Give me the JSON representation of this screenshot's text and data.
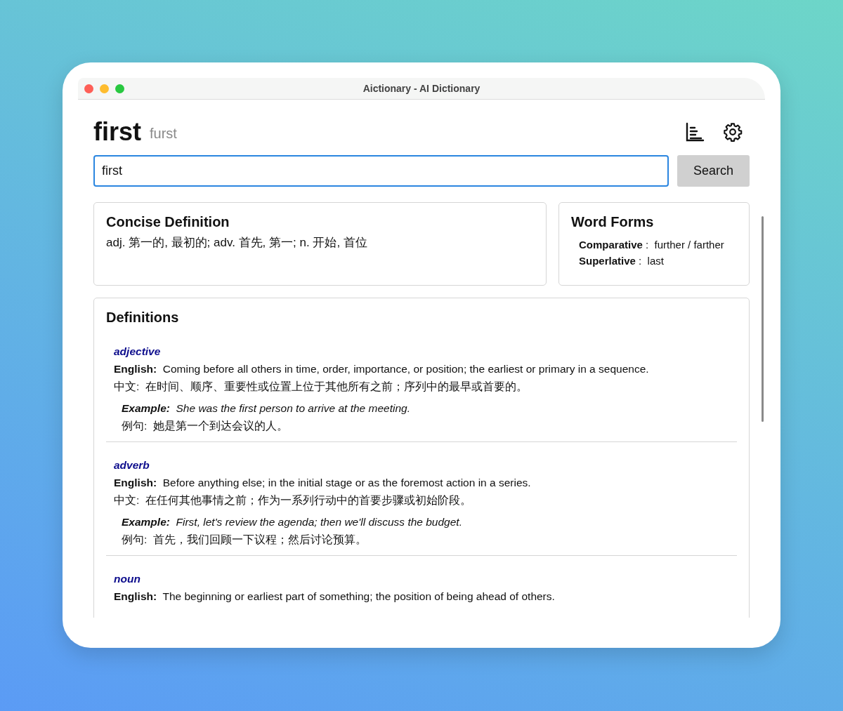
{
  "window": {
    "title": "Aictionary - AI Dictionary"
  },
  "header": {
    "word": "first",
    "pronunciation": "furst"
  },
  "search": {
    "value": "first",
    "button": "Search"
  },
  "concise": {
    "title": "Concise Definition",
    "text": "adj. 第一的, 最初的; adv. 首先, 第一; n. 开始, 首位"
  },
  "word_forms": {
    "title": "Word Forms",
    "items": [
      {
        "text": "**Comparative** :  further / farther"
      },
      {
        "text": "**Superlative** :  last"
      }
    ]
  },
  "definitions": {
    "title": "Definitions",
    "entries": [
      {
        "pos": "adjective",
        "english": "**English:**  Coming before all others in time, order, importance, or position; the earliest or primary in a sequence.",
        "chinese": "中文:  在时间、顺序、重要性或位置上位于其他所有之前；序列中的最早或首要的。",
        "example": "**Example:**  She was the first person to arrive at the meeting.",
        "example_cn": "例句:  她是第一个到达会议的人。"
      },
      {
        "pos": "adverb",
        "english": "**English:**  Before anything else; in the initial stage or as the foremost action in a series.",
        "chinese": "中文:  在任何其他事情之前；作为一系列行动中的首要步骤或初始阶段。",
        "example": "**Example:**  First, let's review the agenda; then we'll discuss the budget.",
        "example_cn": "例句:  首先，我们回顾一下议程；然后讨论预算。"
      },
      {
        "pos": "noun",
        "english": "**English:**  The beginning or earliest part of something; the position of being ahead of others."
      }
    ]
  }
}
